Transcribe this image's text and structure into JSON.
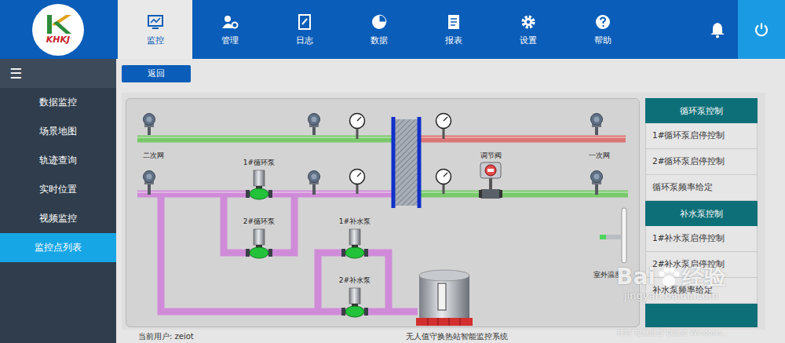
{
  "logo": {
    "text": "KHKJ"
  },
  "nav": [
    {
      "label": "监控",
      "selected": true
    },
    {
      "label": "管理",
      "selected": false
    },
    {
      "label": "日志",
      "selected": false
    },
    {
      "label": "数据",
      "selected": false
    },
    {
      "label": "报表",
      "selected": false
    },
    {
      "label": "设置",
      "selected": false
    },
    {
      "label": "帮助",
      "selected": false
    }
  ],
  "sidebar": {
    "menu_icon": "☰",
    "items": [
      {
        "label": "数据监控",
        "selected": false
      },
      {
        "label": "场景地图",
        "selected": false
      },
      {
        "label": "轨迹查询",
        "selected": false
      },
      {
        "label": "实时位置",
        "selected": false
      },
      {
        "label": "视频监控",
        "selected": false
      },
      {
        "label": "监控点列表",
        "selected": true
      }
    ]
  },
  "back_button": "返回",
  "diagram": {
    "network_labels": [
      "二次网",
      "一次网"
    ],
    "pumps": [
      {
        "label": "1#循环泵"
      },
      {
        "label": "2#循环泵"
      },
      {
        "label": "1#补水泵"
      },
      {
        "label": "2#补水泵"
      }
    ],
    "valve": {
      "label": "调节阀"
    },
    "outdoor_temp": {
      "label": "室外温度"
    }
  },
  "control_panel": {
    "sections": [
      {
        "title": "循环泵控制",
        "items": [
          "1#循环泵启停控制",
          "2#循环泵启停控制",
          "循环泵频率给定"
        ]
      },
      {
        "title": "补水泵控制",
        "items": [
          "1#补水泵启停控制",
          "2#补水泵启停控制",
          "补水泵频率给定"
        ]
      }
    ]
  },
  "status_bar": {
    "user": "当前用户: zeiot",
    "title": "无人值守换热站智能监控系统"
  },
  "watermark": {
    "brand": "Bai",
    "brand_suffix": "经验",
    "url": "jingyan.baidu.com",
    "notice": "转到“电脑设置”以激活 Windows。"
  }
}
